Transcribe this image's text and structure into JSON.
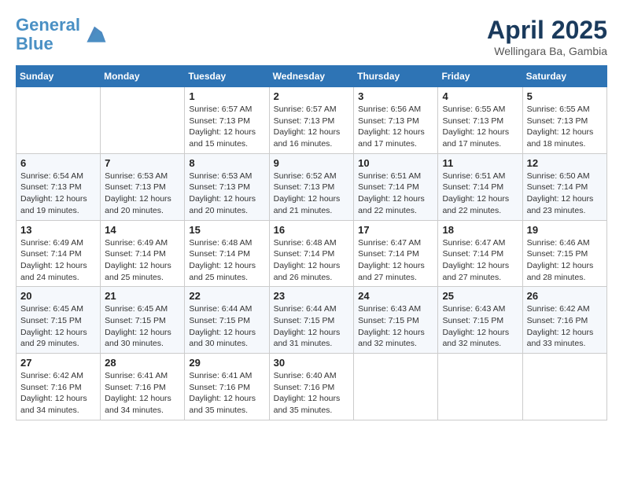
{
  "header": {
    "logo_line1": "General",
    "logo_line2": "Blue",
    "month_year": "April 2025",
    "location": "Wellingara Ba, Gambia"
  },
  "weekdays": [
    "Sunday",
    "Monday",
    "Tuesday",
    "Wednesday",
    "Thursday",
    "Friday",
    "Saturday"
  ],
  "weeks": [
    [
      {
        "day": "",
        "info": ""
      },
      {
        "day": "",
        "info": ""
      },
      {
        "day": "1",
        "info": "Sunrise: 6:57 AM\nSunset: 7:13 PM\nDaylight: 12 hours\nand 15 minutes."
      },
      {
        "day": "2",
        "info": "Sunrise: 6:57 AM\nSunset: 7:13 PM\nDaylight: 12 hours\nand 16 minutes."
      },
      {
        "day": "3",
        "info": "Sunrise: 6:56 AM\nSunset: 7:13 PM\nDaylight: 12 hours\nand 17 minutes."
      },
      {
        "day": "4",
        "info": "Sunrise: 6:55 AM\nSunset: 7:13 PM\nDaylight: 12 hours\nand 17 minutes."
      },
      {
        "day": "5",
        "info": "Sunrise: 6:55 AM\nSunset: 7:13 PM\nDaylight: 12 hours\nand 18 minutes."
      }
    ],
    [
      {
        "day": "6",
        "info": "Sunrise: 6:54 AM\nSunset: 7:13 PM\nDaylight: 12 hours\nand 19 minutes."
      },
      {
        "day": "7",
        "info": "Sunrise: 6:53 AM\nSunset: 7:13 PM\nDaylight: 12 hours\nand 20 minutes."
      },
      {
        "day": "8",
        "info": "Sunrise: 6:53 AM\nSunset: 7:13 PM\nDaylight: 12 hours\nand 20 minutes."
      },
      {
        "day": "9",
        "info": "Sunrise: 6:52 AM\nSunset: 7:13 PM\nDaylight: 12 hours\nand 21 minutes."
      },
      {
        "day": "10",
        "info": "Sunrise: 6:51 AM\nSunset: 7:14 PM\nDaylight: 12 hours\nand 22 minutes."
      },
      {
        "day": "11",
        "info": "Sunrise: 6:51 AM\nSunset: 7:14 PM\nDaylight: 12 hours\nand 22 minutes."
      },
      {
        "day": "12",
        "info": "Sunrise: 6:50 AM\nSunset: 7:14 PM\nDaylight: 12 hours\nand 23 minutes."
      }
    ],
    [
      {
        "day": "13",
        "info": "Sunrise: 6:49 AM\nSunset: 7:14 PM\nDaylight: 12 hours\nand 24 minutes."
      },
      {
        "day": "14",
        "info": "Sunrise: 6:49 AM\nSunset: 7:14 PM\nDaylight: 12 hours\nand 25 minutes."
      },
      {
        "day": "15",
        "info": "Sunrise: 6:48 AM\nSunset: 7:14 PM\nDaylight: 12 hours\nand 25 minutes."
      },
      {
        "day": "16",
        "info": "Sunrise: 6:48 AM\nSunset: 7:14 PM\nDaylight: 12 hours\nand 26 minutes."
      },
      {
        "day": "17",
        "info": "Sunrise: 6:47 AM\nSunset: 7:14 PM\nDaylight: 12 hours\nand 27 minutes."
      },
      {
        "day": "18",
        "info": "Sunrise: 6:47 AM\nSunset: 7:14 PM\nDaylight: 12 hours\nand 27 minutes."
      },
      {
        "day": "19",
        "info": "Sunrise: 6:46 AM\nSunset: 7:15 PM\nDaylight: 12 hours\nand 28 minutes."
      }
    ],
    [
      {
        "day": "20",
        "info": "Sunrise: 6:45 AM\nSunset: 7:15 PM\nDaylight: 12 hours\nand 29 minutes."
      },
      {
        "day": "21",
        "info": "Sunrise: 6:45 AM\nSunset: 7:15 PM\nDaylight: 12 hours\nand 30 minutes."
      },
      {
        "day": "22",
        "info": "Sunrise: 6:44 AM\nSunset: 7:15 PM\nDaylight: 12 hours\nand 30 minutes."
      },
      {
        "day": "23",
        "info": "Sunrise: 6:44 AM\nSunset: 7:15 PM\nDaylight: 12 hours\nand 31 minutes."
      },
      {
        "day": "24",
        "info": "Sunrise: 6:43 AM\nSunset: 7:15 PM\nDaylight: 12 hours\nand 32 minutes."
      },
      {
        "day": "25",
        "info": "Sunrise: 6:43 AM\nSunset: 7:15 PM\nDaylight: 12 hours\nand 32 minutes."
      },
      {
        "day": "26",
        "info": "Sunrise: 6:42 AM\nSunset: 7:16 PM\nDaylight: 12 hours\nand 33 minutes."
      }
    ],
    [
      {
        "day": "27",
        "info": "Sunrise: 6:42 AM\nSunset: 7:16 PM\nDaylight: 12 hours\nand 34 minutes."
      },
      {
        "day": "28",
        "info": "Sunrise: 6:41 AM\nSunset: 7:16 PM\nDaylight: 12 hours\nand 34 minutes."
      },
      {
        "day": "29",
        "info": "Sunrise: 6:41 AM\nSunset: 7:16 PM\nDaylight: 12 hours\nand 35 minutes."
      },
      {
        "day": "30",
        "info": "Sunrise: 6:40 AM\nSunset: 7:16 PM\nDaylight: 12 hours\nand 35 minutes."
      },
      {
        "day": "",
        "info": ""
      },
      {
        "day": "",
        "info": ""
      },
      {
        "day": "",
        "info": ""
      }
    ]
  ]
}
